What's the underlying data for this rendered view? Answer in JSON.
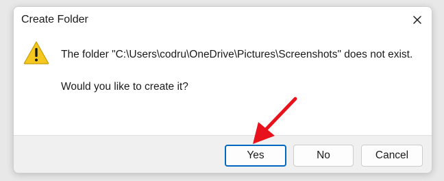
{
  "dialog": {
    "title": "Create Folder",
    "message": "The folder \"C:\\Users\\codru\\OneDrive\\Pictures\\Screenshots\" does not exist.",
    "question": "Would you like to create it?",
    "icon": "warning-icon",
    "buttons": {
      "yes": "Yes",
      "no": "No",
      "cancel": "Cancel"
    }
  },
  "colors": {
    "accent": "#0067c0",
    "warning": "#f4c81f",
    "annotation_arrow": "#e8121c"
  }
}
